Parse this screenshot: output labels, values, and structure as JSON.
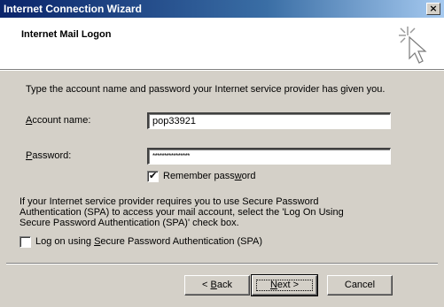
{
  "window": {
    "title": "Internet Connection Wizard",
    "close_glyph": "×"
  },
  "header": {
    "title": "Internet Mail Logon",
    "icon": "wizard-cursor-icon"
  },
  "body": {
    "intro": "Type the account name and password your Internet service provider has given you.",
    "account_label_accel": "A",
    "account_label_rest": "ccount name:",
    "account_value": "pop33921",
    "password_label_accel": "P",
    "password_label_rest": "assword:",
    "password_value": "****************",
    "remember_label_pre": "Remember pass",
    "remember_label_accel": "w",
    "remember_label_post": "ord",
    "remember_checked": true,
    "spa_text": "If your Internet service provider requires you to use Secure Password Authentication (SPA) to access your mail account, select the 'Log On Using Secure Password Authentication (SPA)' check box.",
    "spa_label_pre": "Log on using ",
    "spa_label_accel": "S",
    "spa_label_post": "ecure Password Authentication (SPA)",
    "spa_checked": false
  },
  "buttons": {
    "back_pre": "< ",
    "back_accel": "B",
    "back_post": "ack",
    "next_accel": "N",
    "next_post": "ext >",
    "cancel": "Cancel"
  }
}
